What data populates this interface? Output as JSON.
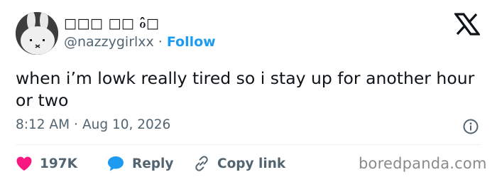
{
  "tweet": {
    "display_name": "□□□ □□ ℴ̂□",
    "handle": "@nazzygirlxx",
    "separator": "·",
    "follow_label": "Follow",
    "text": "when i’m lowk really tired so i stay up for another hour or two",
    "time": "8:12 AM",
    "date": "Aug 10, 2026"
  },
  "actions": {
    "like_count": "197K",
    "reply_label": "Reply",
    "copy_link_label": "Copy link"
  },
  "watermark": "boredpanda.com",
  "colors": {
    "accent": "#1d9bf0",
    "like": "#f91880",
    "text": "#0f1419",
    "muted": "#536471"
  },
  "icons": [
    "x-logo-icon",
    "info-icon",
    "heart-icon",
    "reply-bubble-icon",
    "link-icon"
  ]
}
